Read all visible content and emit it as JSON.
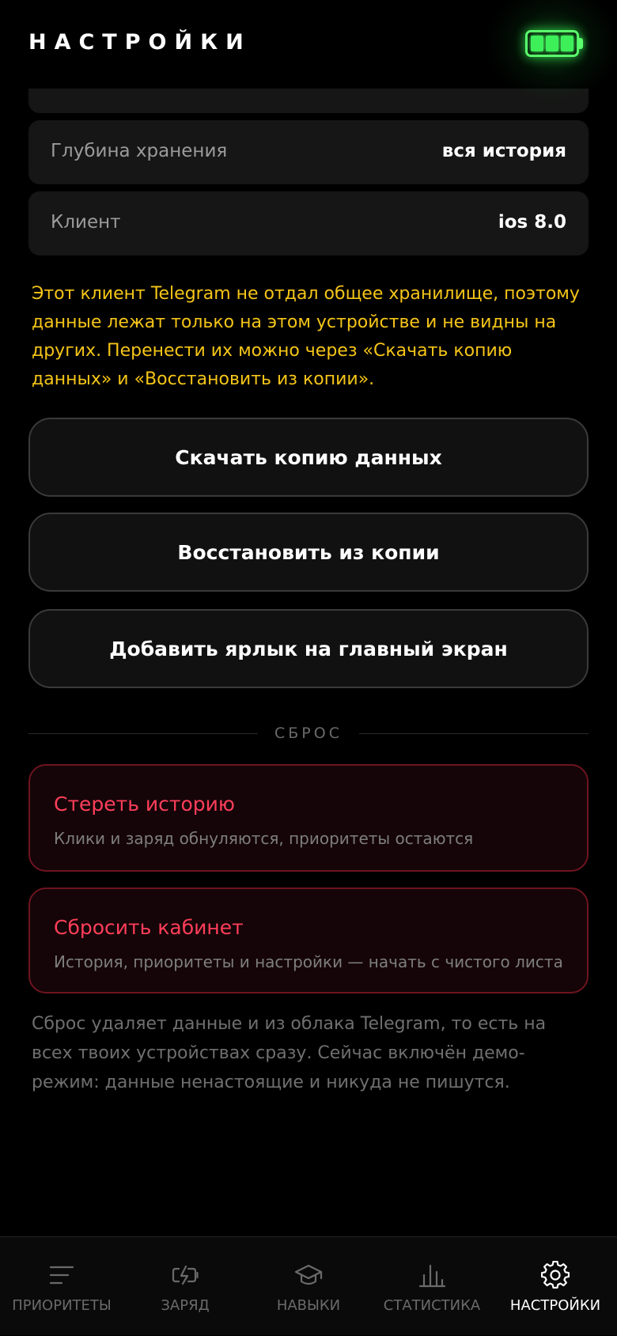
{
  "header": {
    "title": "НАСТРОЙКИ",
    "battery_icon": "battery-full-icon",
    "battery_level": 1.0,
    "battery_color": "#3df05a"
  },
  "info_rows": [
    {
      "label": "Глубина хранения",
      "value": "вся история"
    },
    {
      "label": "Клиент",
      "value": "ios 8.0"
    }
  ],
  "notice": "Этот клиент Telegram не отдал общее хранилище, поэтому данные лежат только на этом устройстве и не видны на других. Перенести их можно через «Скачать копию данных» и «Восстановить из копии».",
  "actions": {
    "download": "Скачать копию данных",
    "restore": "Восстановить из копии",
    "shortcut": "Добавить ярлык на главный экран"
  },
  "reset_section": {
    "title": "СБРОС",
    "clear_history": {
      "title": "Стереть историю",
      "subtitle": "Клики и заряд обнуляются, приоритеты остаются"
    },
    "reset_cabinet": {
      "title": "Сбросить кабинет",
      "subtitle": "История, приоритеты и настройки — начать с чистого листа"
    },
    "note": "Сброс удаляет данные и из облака Telegram, то есть на всех твоих устройствах сразу. Сейчас включён демо-режим: данные ненастоящие и никуда не пишутся."
  },
  "colors": {
    "accent_warning": "#f5c518",
    "danger": "#ff3e5a",
    "active_nav": "#ffffff"
  },
  "nav": [
    {
      "label": "ПРИОРИТЕТЫ",
      "icon": "list-lines-icon",
      "active": false
    },
    {
      "label": "ЗАРЯД",
      "icon": "battery-charge-icon",
      "active": false
    },
    {
      "label": "НАВЫКИ",
      "icon": "graduation-cap-icon",
      "active": false
    },
    {
      "label": "СТАТИСТИКА",
      "icon": "bar-chart-icon",
      "active": false
    },
    {
      "label": "НАСТРОЙКИ",
      "icon": "gear-icon",
      "active": true
    }
  ]
}
